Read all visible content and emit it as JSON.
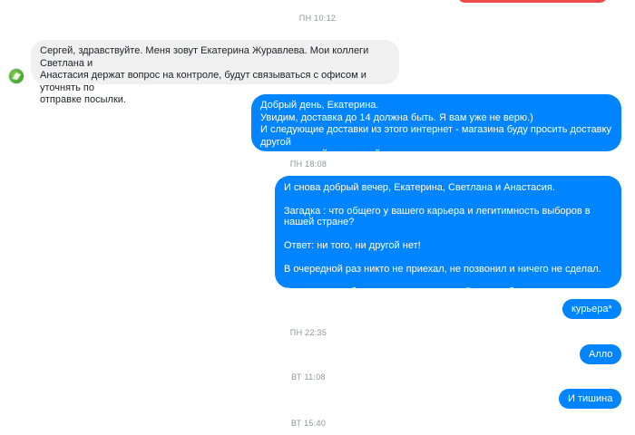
{
  "conversation": {
    "timestamps": {
      "t1": "ПН 10:12",
      "t2": "ПН 18:08",
      "t3": "ПН 22:35",
      "t4": "ВТ 11:08",
      "t5": "ВТ 15:40"
    },
    "messages": {
      "m1": "Сергей, здравствуйте. Меня зовут Екатерина Журавлева. Мои коллеги Светлана и\nАнастасия держат вопрос на контроле, будут связываться с офисом и уточнять по\nотправке посылки.",
      "m2": "Добрый день, Екатерина.\nУвидим, доставка до 14 должна быть. Я вам уже не верю.)\nИ следующие доставки из этого интернет - магазина буду просить доставку другой\nлогистической компанией.",
      "m3": "И снова добрый вечер, Екатерина, Светлана и Анастасия.\n\nЗагадка : что общего у вашего карьера и легитимность выборов в нашей стране?\n\nОтвет: ни того, ни другой нет!\n\nВ очередной раз никто не приехал, не позвонил и ничего не сделал.\n\nСегодня, как обещал, уходит письмо в Роспотребнадзор и пост на Пикабу.",
      "m4": "курьера*",
      "m5": "Алло",
      "m6": "И тишина"
    }
  },
  "colors": {
    "outgoing_bubble": "#0084ff",
    "incoming_bubble": "#f1f0f0",
    "timestamp_text": "#90949c",
    "avatar": "#3fa531",
    "top_edge_bubble": "#ef4b4b"
  },
  "icons": {
    "avatar": "avatar-icon"
  }
}
